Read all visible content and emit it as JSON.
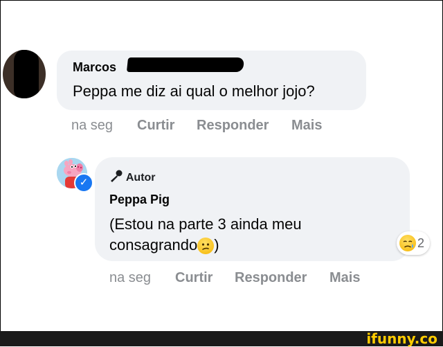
{
  "comment1": {
    "author": "Marcos",
    "text": "Peppa me diz ai qual o melhor jojo?",
    "time": "na seg",
    "like": "Curtir",
    "reply": "Responder",
    "more": "Mais"
  },
  "comment2": {
    "badge_icon": "microphone-icon",
    "badge": "Autor",
    "author": "Peppa Pig",
    "text_line1": "(Estou na parte 3 ainda meu",
    "text_line2_pre": "consagrando",
    "text_line2_post": ")",
    "inline_emoji": "confused-face",
    "time": "na seg",
    "like": "Curtir",
    "reply": "Responder",
    "more": "Mais",
    "reaction_emoji": "sad-tear-face",
    "reaction_count": "2"
  },
  "watermark": "ifunny.co",
  "colors": {
    "bubble": "#f0f2f5",
    "verified": "#1877f2",
    "watermark": "#ffcc00",
    "muted": "#8a8d91"
  }
}
